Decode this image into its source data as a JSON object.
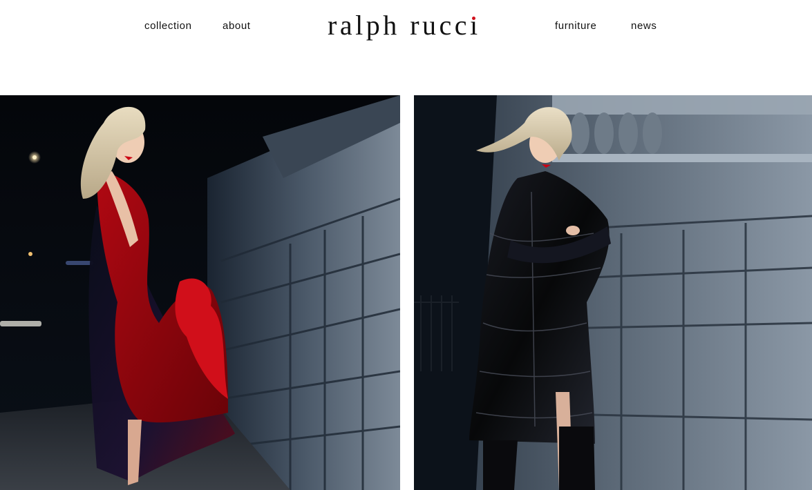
{
  "header": {
    "logo_text_main": "ralph rucc",
    "logo_text_last": "ı",
    "nav_left": [
      "collection",
      "about"
    ],
    "nav_right": [
      "furniture",
      "news"
    ]
  },
  "colors": {
    "background": "#ffffff",
    "text": "#111111",
    "logo_accent": "#d0101c"
  },
  "gallery": {
    "images": [
      {
        "name": "red-dress-photo"
      },
      {
        "name": "black-coat-photo"
      }
    ]
  }
}
